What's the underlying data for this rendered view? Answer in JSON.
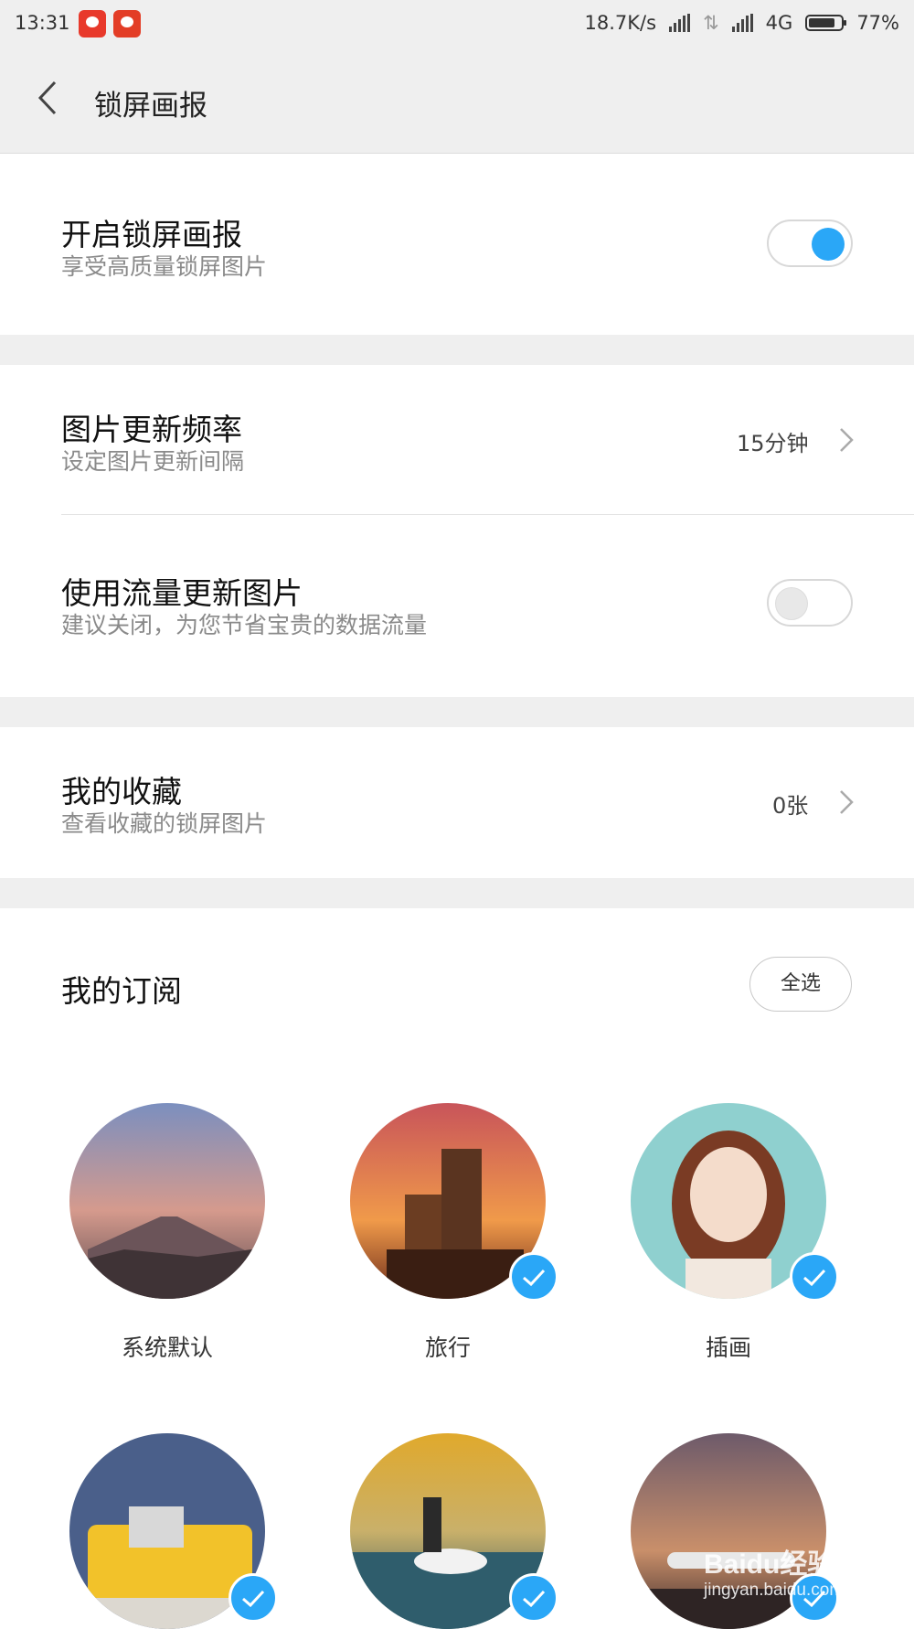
{
  "status": {
    "time": "13:31",
    "net_speed": "18.7K/s",
    "network_type": "4G",
    "battery": "77%"
  },
  "header": {
    "title": "锁屏画报"
  },
  "settings": {
    "enable": {
      "title": "开启锁屏画报",
      "subtitle": "享受高质量锁屏图片",
      "on": true
    },
    "frequency": {
      "title": "图片更新频率",
      "subtitle": "设定图片更新间隔",
      "value": "15分钟"
    },
    "mobile_data": {
      "title": "使用流量更新图片",
      "subtitle": "建议关闭，为您节省宝贵的数据流量",
      "on": false
    },
    "favorites": {
      "title": "我的收藏",
      "subtitle": "查看收藏的锁屏图片",
      "value": "0张"
    }
  },
  "subscriptions": {
    "title": "我的订阅",
    "select_all": "全选",
    "items": [
      {
        "label": "系统默认",
        "checked": false
      },
      {
        "label": "旅行",
        "checked": true
      },
      {
        "label": "插画",
        "checked": true
      },
      {
        "label": "",
        "checked": true
      },
      {
        "label": "",
        "checked": true
      },
      {
        "label": "",
        "checked": true
      }
    ]
  },
  "watermark": {
    "brand": "Baidu经验",
    "url": "jingyan.baidu.com"
  },
  "colors": {
    "accent": "#2aa7f7",
    "background": "#efefef"
  }
}
